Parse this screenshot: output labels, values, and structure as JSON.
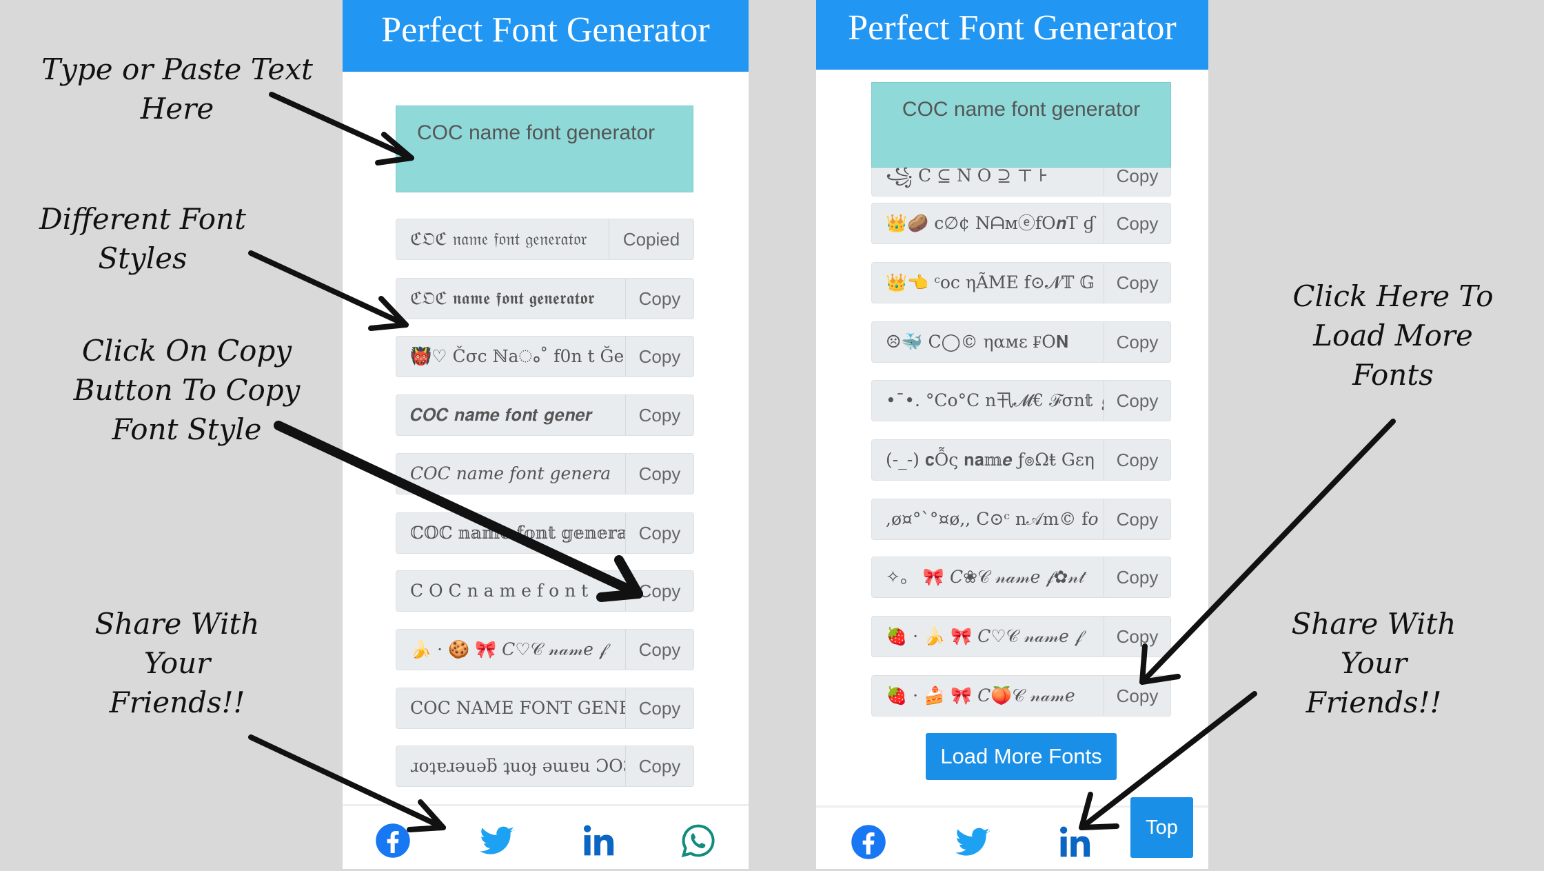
{
  "colors": {
    "header": "#2196f3",
    "input": "#8fd9d9",
    "row": "#e9ecef",
    "button": "#1a8fe8",
    "background": "#d9d9d9"
  },
  "left": {
    "title": "Perfect Font Generator",
    "input_value": "COC name font generator",
    "rows": [
      {
        "text": "ℭ𝔒ℭ 𝔫𝔞𝔪𝔢 𝔣𝔬𝔫𝔱 𝔤𝔢𝔫𝔢𝔯𝔞𝔱𝔬𝔯",
        "button": "Copied"
      },
      {
        "text": "ℭ𝔒ℭ 𝖓𝖆𝖒𝖊 𝖋𝖔𝖓𝖙 𝖌𝖊𝖓𝖊𝖗𝖆𝖙𝖔𝖗",
        "button": "Copy"
      },
      {
        "text": "👹♡  Čσc ℕaം˚ f0n t  Ğe",
        "button": "Copy"
      },
      {
        "text": "𝑪𝑶𝑪 𝒏𝒂𝒎𝒆 𝒇𝒐𝒏𝒕 𝒈𝒆𝒏𝒆𝒓",
        "button": "Copy"
      },
      {
        "text": "𝐶𝑂𝐶 𝑛𝑎𝑚𝑒 𝑓𝑜𝑛𝑡 𝑔𝑒𝑛𝑒𝑟𝑎",
        "button": "Copy"
      },
      {
        "text": "ℂ𝕆ℂ 𝕟𝕒𝕞𝕖 𝕗𝕠𝕟𝕥 𝕘𝕖𝕟𝕖𝕣𝕒𝕥",
        "button": "Copy"
      },
      {
        "text": "C O C  n a m e  f o n t",
        "button": "Copy"
      },
      {
        "text": "🍌 · 🍪 🎀  𝐶♡𝒞 𝓃𝒶𝓂𝑒 𝒻",
        "button": "Copy"
      },
      {
        "text": "COC NAME FONT GENERATOR",
        "button": "Copy"
      },
      {
        "text": "ɹoʇɐɹǝuǝƃ ʇuoɟ ǝɯɐu ƆOƆ",
        "button": "Copy"
      }
    ],
    "share_icons": [
      "facebook-icon",
      "twitter-icon",
      "linkedin-icon",
      "whatsapp-icon"
    ]
  },
  "right": {
    "title": "Perfect Font Generator",
    "input_value": "COC name font generator",
    "partial_row": {
      "text": "꧁ C ⊆ N O  ⊇ ⊤ ⊦",
      "button": "Copy"
    },
    "rows": [
      {
        "text": "👑🥔  c∅¢ NᗩмⓔfO𝒏T ɠ",
        "button": "Copy"
      },
      {
        "text": "👑👈  ᶜoc ηÃME f⊙𝓝𝕋 𝔾",
        "button": "Copy"
      },
      {
        "text": "☹🐳  C◯© ηαмε ₣O𝐍",
        "button": "Copy"
      },
      {
        "text": "•¯•. °Co°C n卂𝓜€ ℱσn𝕥 ℊ",
        "button": "Copy"
      },
      {
        "text": "(-_-) 𝐜Ỗς 𝐧𝐚𝕞𝒆 ƒ๏Ωŧ Gεη",
        "button": "Copy"
      },
      {
        "text": ",ø¤°`°¤ø,, C⊙ᶜ n𝒜m© f𝑜",
        "button": "Copy"
      },
      {
        "text": "✧。 🎀  𝐶❀𝒞 𝓃𝒶𝓂𝑒 𝒻✿𝓃𝓉",
        "button": "Copy"
      },
      {
        "text": "🍓 · 🍌 🎀  𝐶♡𝒞 𝓃𝒶𝓂𝑒 𝒻",
        "button": "Copy"
      },
      {
        "text": "🍓 · 🍰 🎀  𝐶🍑𝒞 𝓃𝒶𝓂𝑒",
        "button": "Copy"
      }
    ],
    "load_more": "Load More Fonts",
    "top": "Top",
    "share_icons": [
      "facebook-icon",
      "twitter-icon",
      "linkedin-icon"
    ]
  },
  "annotations": {
    "type_text": [
      "Type or Paste Text",
      "Here"
    ],
    "font_styles": [
      "Different Font",
      "Styles"
    ],
    "click_copy": [
      "Click On Copy",
      "Button To Copy",
      "Font Style"
    ],
    "share_left": [
      "Share With",
      "Your",
      "Friends!!"
    ],
    "load_more": [
      "Click Here To",
      "Load More",
      "Fonts"
    ],
    "share_right": [
      "Share With",
      "Your",
      "Friends!!"
    ]
  }
}
